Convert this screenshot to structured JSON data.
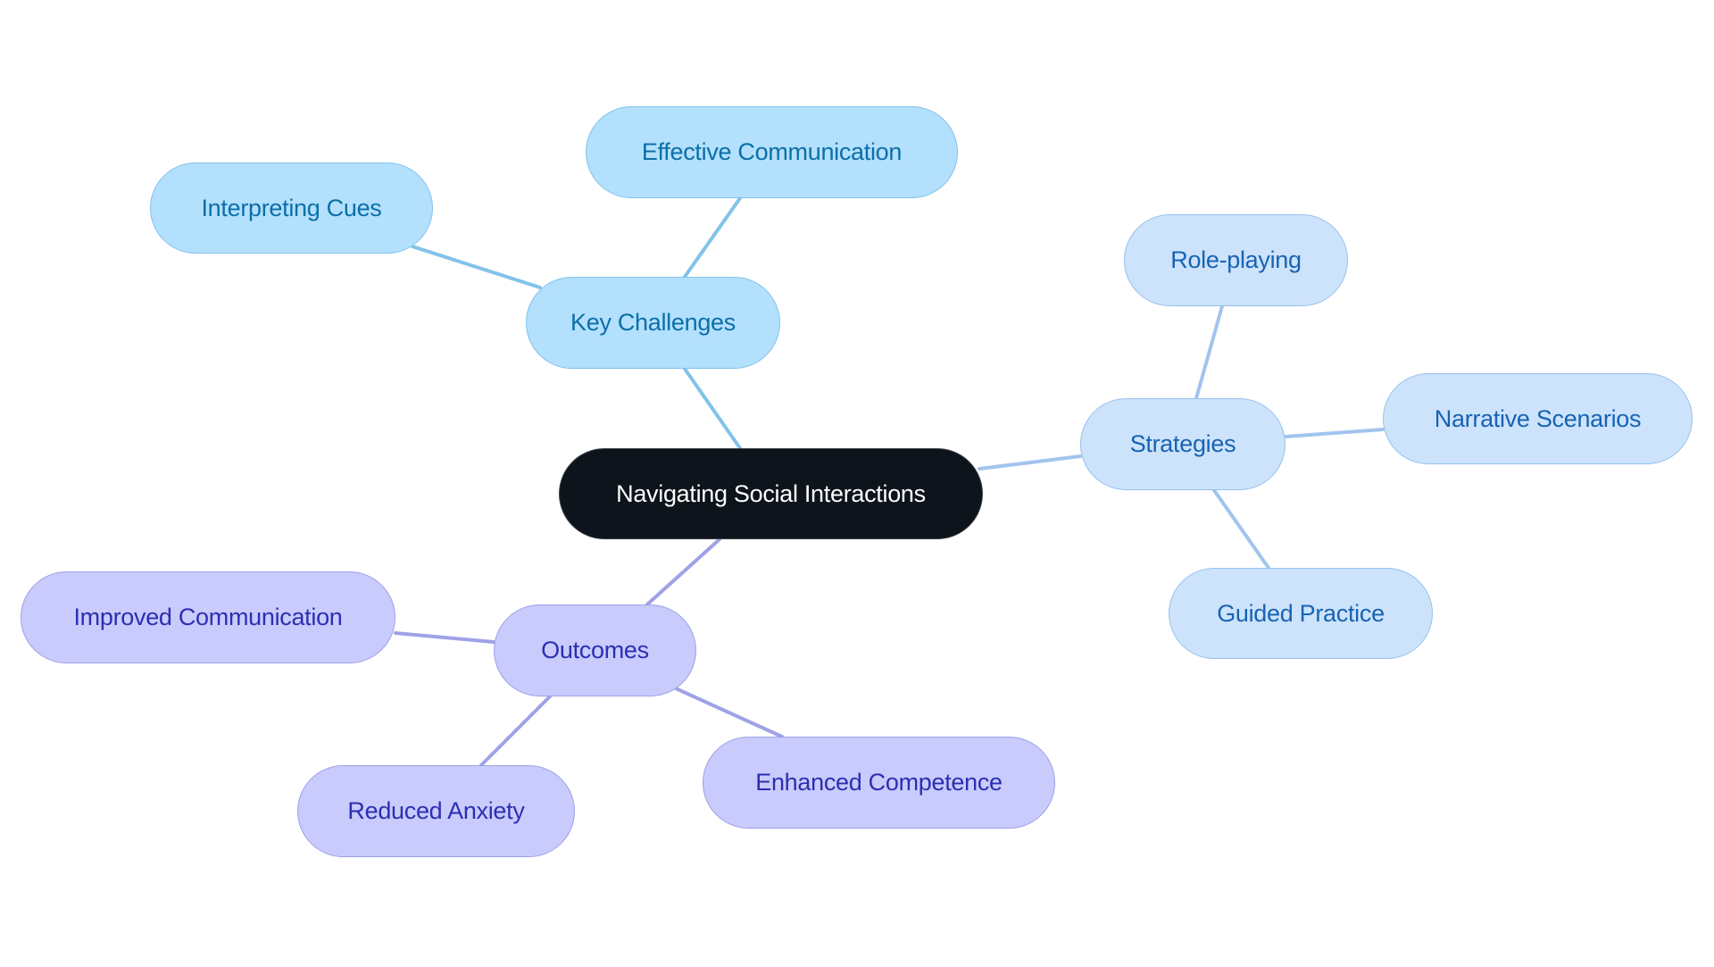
{
  "diagram": {
    "type": "mindmap",
    "root": {
      "id": "root",
      "label": "Navigating Social Interactions"
    },
    "branches": [
      {
        "id": "key-challenges",
        "label": "Key Challenges",
        "style": "b1",
        "edge_color": "#82c2ea",
        "children": [
          {
            "id": "effective-communication",
            "label": "Effective Communication"
          },
          {
            "id": "interpreting-cues",
            "label": "Interpreting Cues"
          }
        ]
      },
      {
        "id": "strategies",
        "label": "Strategies",
        "style": "b2",
        "edge_color": "#a2c4ee",
        "children": [
          {
            "id": "role-playing",
            "label": "Role-playing"
          },
          {
            "id": "narrative-scenarios",
            "label": "Narrative Scenarios"
          },
          {
            "id": "guided-practice",
            "label": "Guided Practice"
          }
        ]
      },
      {
        "id": "outcomes",
        "label": "Outcomes",
        "style": "b3",
        "edge_color": "#9fa2e6",
        "children": [
          {
            "id": "improved-communication",
            "label": "Improved Communication"
          },
          {
            "id": "reduced-anxiety",
            "label": "Reduced Anxiety"
          },
          {
            "id": "enhanced-competence",
            "label": "Enhanced Competence"
          }
        ]
      }
    ]
  },
  "colors": {
    "root_fill": "#0d141b",
    "key_challenges_fill": "#b3e0fc",
    "strategies_fill": "#cce3fb",
    "outcomes_fill": "#c8cbfc"
  }
}
